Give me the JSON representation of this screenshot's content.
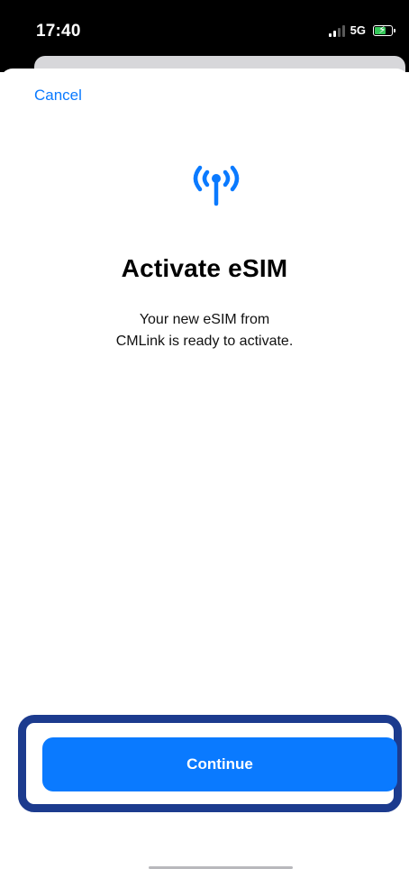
{
  "status_bar": {
    "time": "17:40",
    "network": "5G",
    "battery_icon": "battery-charging-icon",
    "signal_icon": "cellular-signal-icon"
  },
  "nav": {
    "cancel_label": "Cancel"
  },
  "main": {
    "icon": "cellular-antenna-icon",
    "title": "Activate eSIM",
    "description_line1": "Your new eSIM from",
    "description_line2": "CMLink is ready to activate."
  },
  "footer": {
    "continue_label": "Continue"
  },
  "colors": {
    "accent": "#0a7aff",
    "highlight_frame": "#1c3b8e",
    "status_bar_bg": "#000000"
  }
}
